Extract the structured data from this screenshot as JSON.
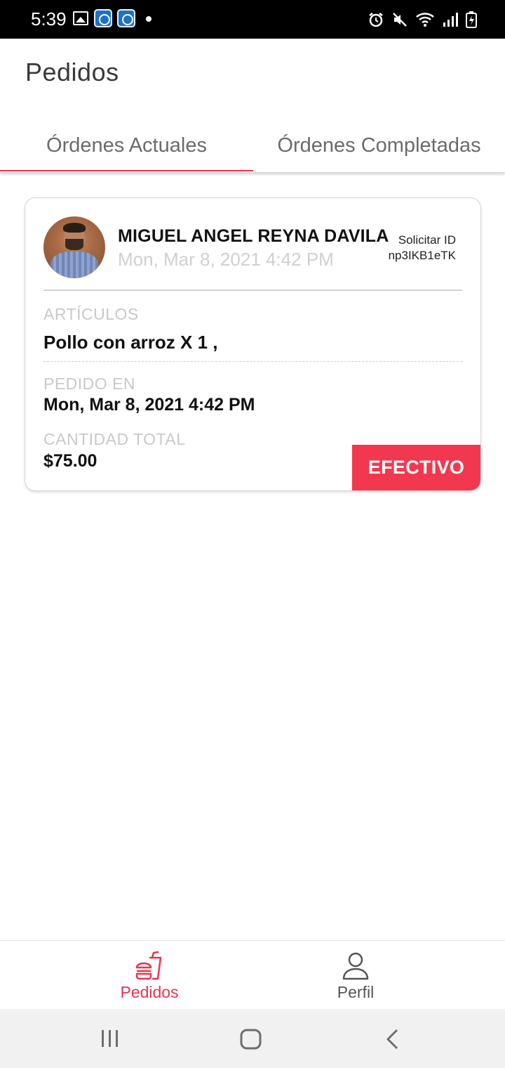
{
  "status_bar": {
    "time": "5:39",
    "left_icons": [
      "image-icon",
      "app-icon",
      "app-icon",
      "dot-icon"
    ],
    "right_icons": [
      "alarm-icon",
      "mute-icon",
      "wifi-icon",
      "signal-icon",
      "battery-icon"
    ]
  },
  "header": {
    "title": "Pedidos"
  },
  "tabs": [
    {
      "label": "Órdenes Actuales",
      "active": true
    },
    {
      "label": "Órdenes Completadas",
      "active": false
    }
  ],
  "accent_color": "#e8354f",
  "order": {
    "customer_name": "MIGUEL ANGEL REYNA DAVILA",
    "datetime": "Mon, Mar 8, 2021 4:42 PM",
    "request_id_label": "Solicitar ID",
    "request_id": "np3IKB1eTK",
    "items_label": "ARTÍCULOS",
    "items_value": "Pollo con arroz X 1 ,",
    "ordered_label": "PEDIDO EN",
    "ordered_value": "Mon, Mar 8, 2021 4:42 PM",
    "total_label": "CANTIDAD TOTAL",
    "total_value": "$75.00",
    "payment_method": "EFECTIVO"
  },
  "bottom_nav": [
    {
      "label": "Pedidos",
      "icon": "fast-food-icon",
      "active": true
    },
    {
      "label": "Perfil",
      "icon": "person-icon",
      "active": false
    }
  ],
  "system_nav": [
    "recents-icon",
    "home-icon",
    "back-icon"
  ]
}
